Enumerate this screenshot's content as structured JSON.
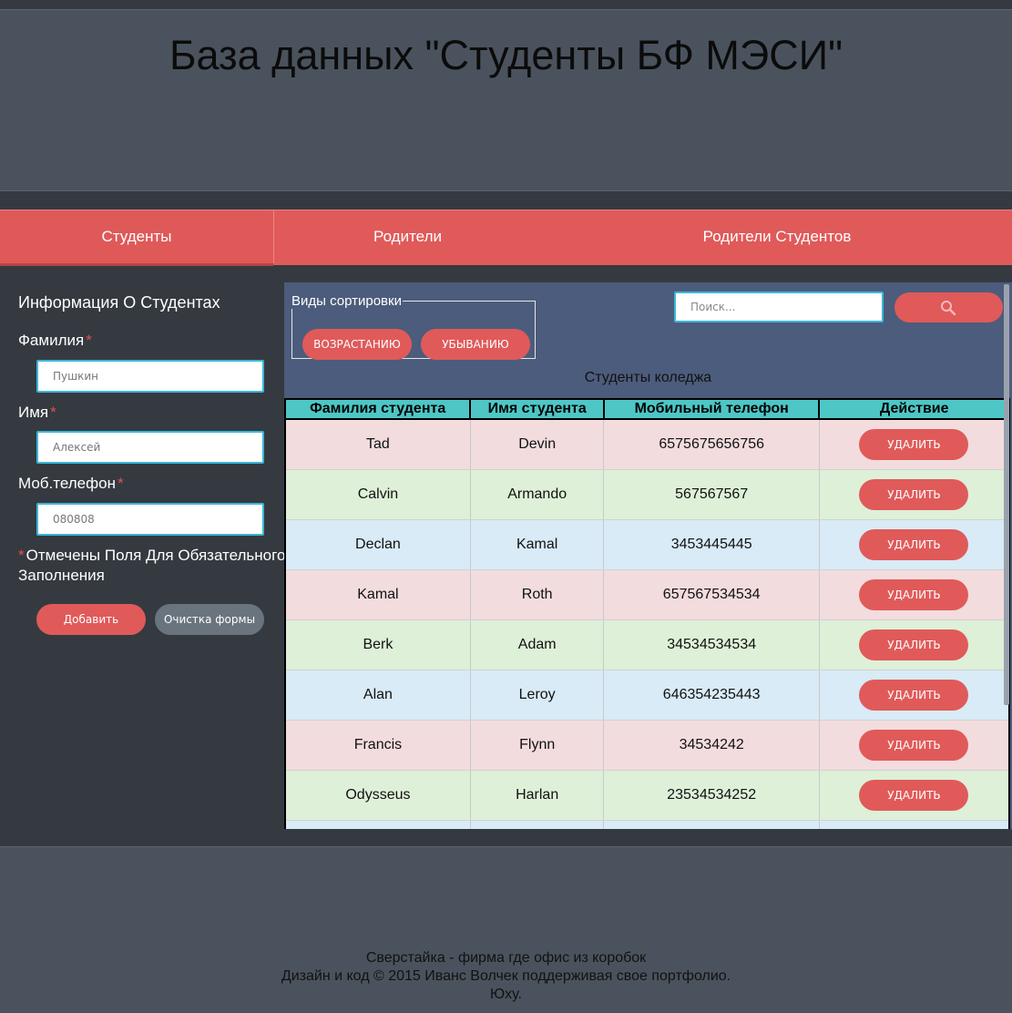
{
  "header": {
    "title": "База данных \"Студенты БФ МЭСИ\""
  },
  "nav": {
    "tabs": [
      {
        "label": "Студенты"
      },
      {
        "label": "Родители"
      },
      {
        "label": "Родители Студентов"
      }
    ]
  },
  "sidebar": {
    "title": "Информация О Студентах",
    "fields": [
      {
        "label": "Фамилия",
        "required": "*",
        "value": "Пушкин"
      },
      {
        "label": "Имя",
        "required": "*",
        "value": "Алексей"
      },
      {
        "label": "Моб.телефон",
        "required": "*",
        "value": "080808"
      }
    ],
    "note_star": "*",
    "note": "Отмечены Поля Для Обязательного",
    "note2": "Заполнения",
    "add_label": "Добавить",
    "clear_label": "Очистка формы"
  },
  "sort": {
    "legend": "Виды сортировки",
    "asc_label": "ВОЗРАСТАНИЮ",
    "desc_label": "УБЫВАНИЮ"
  },
  "search": {
    "placeholder": "Поиск..."
  },
  "table": {
    "caption": "Студенты коледжа",
    "headers": [
      "Фамилия студента",
      "Имя студента",
      "Мобильный телефон",
      "Действие"
    ],
    "delete_label": "УДАЛИТЬ",
    "rows": [
      {
        "last": "Tad",
        "first": "Devin",
        "phone": "6575675656756"
      },
      {
        "last": "Calvin",
        "first": "Armando",
        "phone": "567567567"
      },
      {
        "last": "Declan",
        "first": "Kamal",
        "phone": "3453445445"
      },
      {
        "last": "Kamal",
        "first": "Roth",
        "phone": "657567534534"
      },
      {
        "last": "Berk",
        "first": "Adam",
        "phone": "34534534534"
      },
      {
        "last": "Alan",
        "first": "Leroy",
        "phone": "646354235443"
      },
      {
        "last": "Francis",
        "first": "Flynn",
        "phone": "34534242"
      },
      {
        "last": "Odysseus",
        "first": "Harlan",
        "phone": "23534534252"
      }
    ]
  },
  "footer": {
    "line1": "Сверстайка - фирма где офис из коробок",
    "line2": "Дизайн и код © 2015 Иванс Волчек поддерживая свое портфолио.",
    "line3": "Юху."
  }
}
